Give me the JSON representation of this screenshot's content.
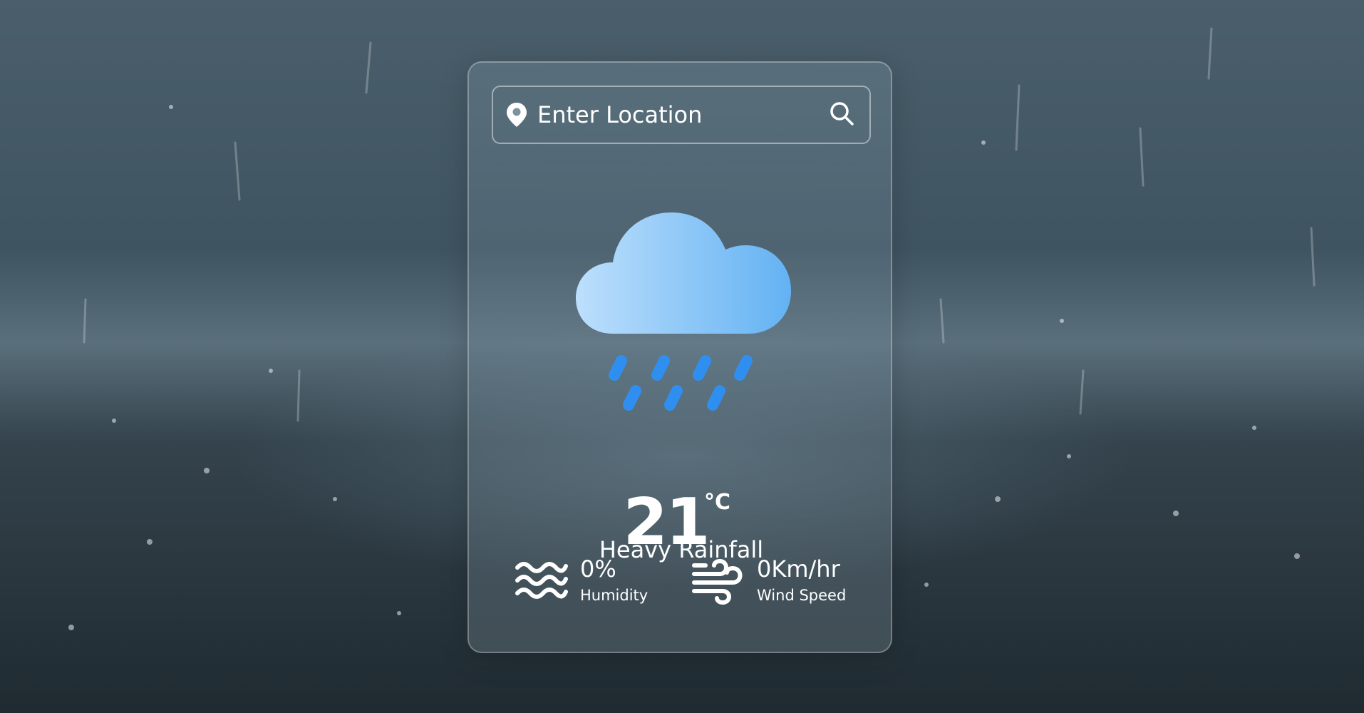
{
  "search": {
    "placeholder": "Enter Location",
    "location_icon": "location-pin-icon",
    "search_icon": "search-icon"
  },
  "weather": {
    "icon": "heavy-rain-cloud-icon",
    "temperature": "21",
    "unit": "°C",
    "condition": "Heavy Rainfall"
  },
  "details": {
    "humidity": {
      "icon": "humidity-waves-icon",
      "value": "0%",
      "label": "Humidity"
    },
    "wind": {
      "icon": "wind-icon",
      "value": "0Km/hr",
      "label": "Wind Speed"
    }
  },
  "colors": {
    "text": "#ffffff",
    "cloud_light": "#b9dcfb",
    "cloud_dark": "#66b4f4",
    "rain": "#2f8ff0"
  }
}
